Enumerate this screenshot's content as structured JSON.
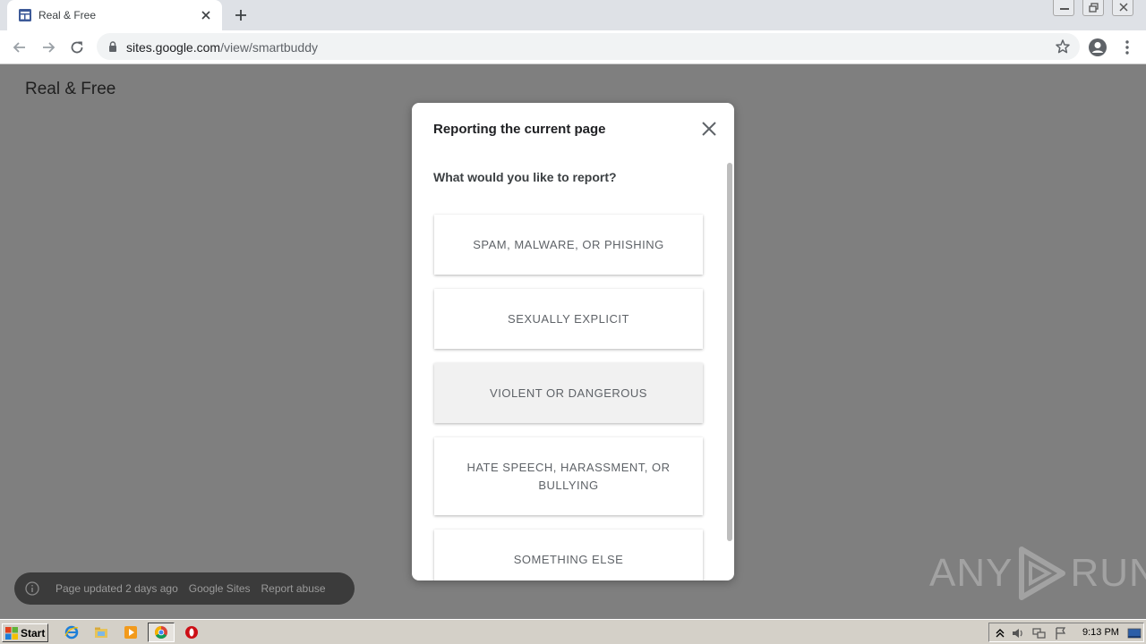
{
  "browser": {
    "tab_title": "Real & Free",
    "url_domain": "sites.google.com",
    "url_path": "/view/smartbuddy"
  },
  "page": {
    "site_title": "Real & Free"
  },
  "dialog": {
    "title": "Reporting the current page",
    "question": "What would you like to report?",
    "options": [
      "SPAM, MALWARE, OR PHISHING",
      "SEXUALLY EXPLICIT",
      "VIOLENT OR DANGEROUS",
      "HATE SPEECH, HARASSMENT, OR BULLYING",
      "SOMETHING ELSE"
    ]
  },
  "snackbar": {
    "updated": "Page updated 2 days ago",
    "sites_link": "Google Sites",
    "abuse_link": "Report abuse"
  },
  "watermark": {
    "left": "ANY",
    "right": "RUN"
  },
  "taskbar": {
    "start_label": "Start",
    "clock": "9:13 PM"
  },
  "colors": {
    "overlay": "#7f7f7f",
    "dialog_bg": "#ffffff",
    "snackbar_bg": "#3b3b3b",
    "taskbar_bg": "#d4d0c8"
  }
}
